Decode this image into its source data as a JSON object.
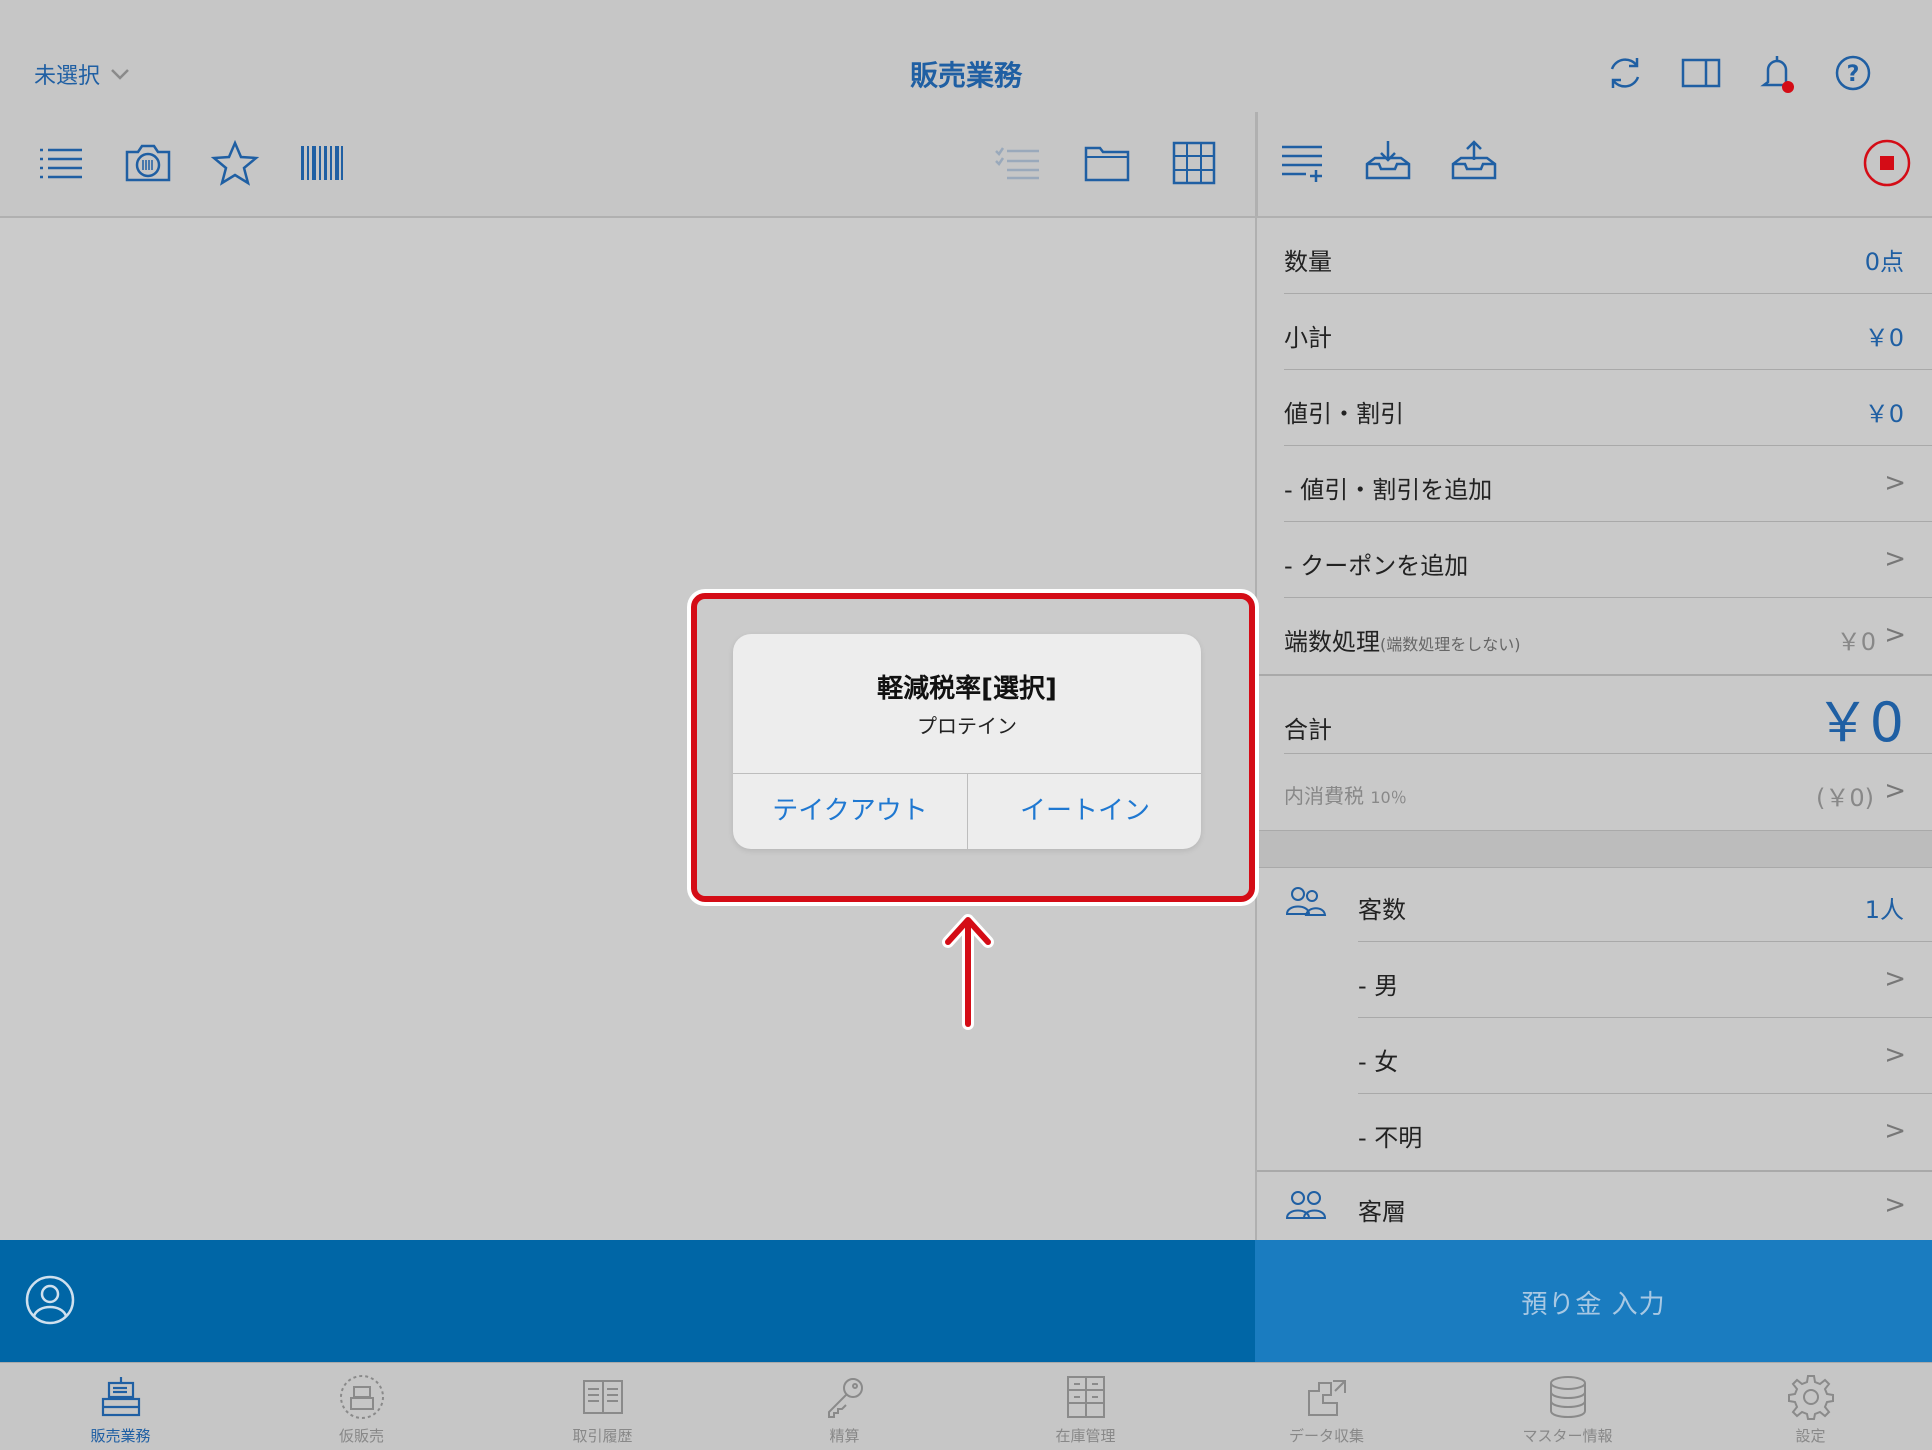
{
  "header": {
    "store_select": "未選択",
    "title": "販売業務"
  },
  "summary": {
    "quantity_label": "数量",
    "quantity_value": "0点",
    "subtotal_label": "小計",
    "subtotal_value": "￥0",
    "discount_label": "値引・割引",
    "discount_value": "￥0",
    "add_discount_label": "- 値引・割引を追加",
    "add_coupon_label": "- クーポンを追加",
    "rounding_label": "端数処理",
    "rounding_note": "(端数処理をしない)",
    "rounding_value": "￥0",
    "total_label": "合計",
    "total_value": "￥0",
    "tax_label": "内消費税",
    "tax_rate": "10％",
    "tax_value": "(￥0)"
  },
  "customers": {
    "count_label": "客数",
    "count_value": "1人",
    "male_label": "- 男",
    "female_label": "- 女",
    "unknown_label": "- 不明",
    "segment_label": "客層"
  },
  "dialog": {
    "title": "軽減税率[選択]",
    "message": "プロテイン",
    "takeout_label": "テイクアウト",
    "eatin_label": "イートイン"
  },
  "deposit_label": "預り金 入力",
  "tabs": [
    {
      "label": "販売業務",
      "icon": "register-icon"
    },
    {
      "label": "仮販売",
      "icon": "temp-sale-icon"
    },
    {
      "label": "取引履歴",
      "icon": "history-book-icon"
    },
    {
      "label": "精算",
      "icon": "key-icon"
    },
    {
      "label": "在庫管理",
      "icon": "inventory-icon"
    },
    {
      "label": "データ収集",
      "icon": "data-collect-icon"
    },
    {
      "label": "マスター情報",
      "icon": "database-icon"
    },
    {
      "label": "設定",
      "icon": "gear-icon"
    }
  ],
  "colors": {
    "accent": "#1f5fa3",
    "highlight_red": "#d40c16",
    "bottom_blue": "#0066a6",
    "deposit_blue": "#1a7cc0"
  }
}
